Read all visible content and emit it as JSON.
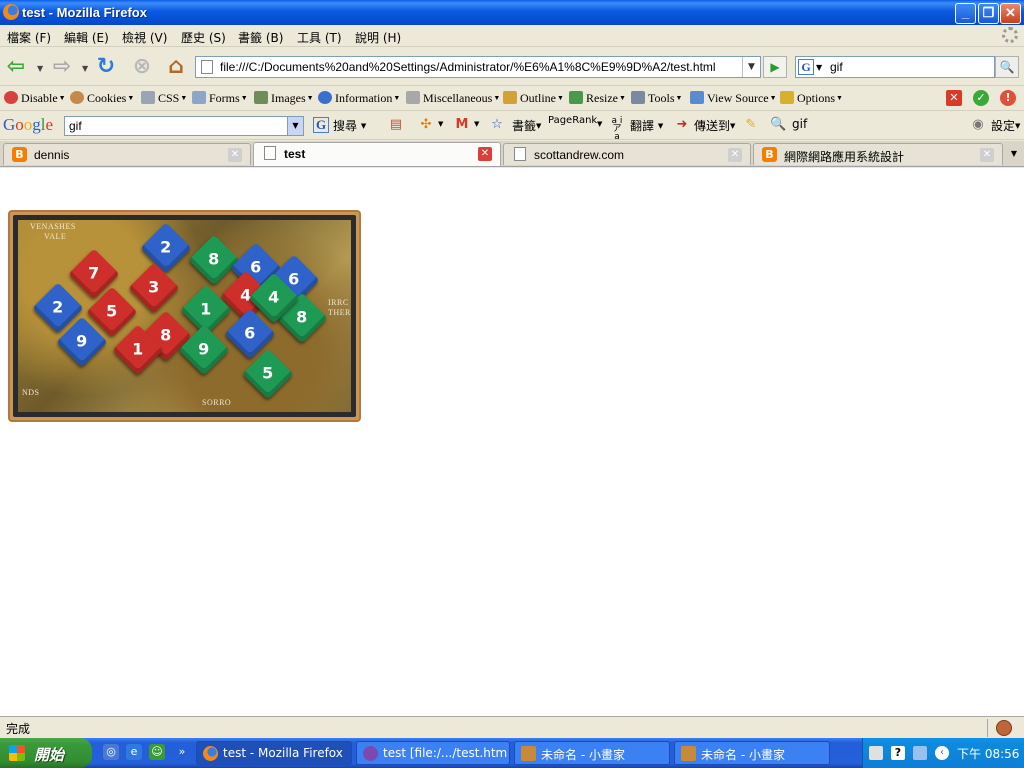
{
  "window": {
    "title": "test - Mozilla Firefox"
  },
  "menu": [
    "檔案 (F)",
    "編輯 (E)",
    "檢視 (V)",
    "歷史 (S)",
    "書籤 (B)",
    "工具 (T)",
    "說明 (H)"
  ],
  "nav": {
    "url": "file:///C:/Documents%20and%20Settings/Administrator/%E6%A1%8C%E9%9D%A2/test.html",
    "search_value": "gif"
  },
  "devtoolbar": {
    "items": [
      "Disable",
      "Cookies",
      "CSS",
      "Forms",
      "Images",
      "Information",
      "Miscellaneous",
      "Outline",
      "Resize",
      "Tools",
      "View Source",
      "Options"
    ]
  },
  "googlebar": {
    "logo": "Google",
    "search_value": "gif",
    "search_label": "搜尋",
    "bookmarks_label": "書籤",
    "pagerank_label": "PageRank",
    "translate_label": "翻譯",
    "sendto_label": "傳送到",
    "gif_label": "gif",
    "settings_label": "設定"
  },
  "tabs": [
    {
      "label": "dennis",
      "active": false
    },
    {
      "label": "test",
      "active": true
    },
    {
      "label": "scottandrew.com",
      "active": false
    },
    {
      "label": "網際網路應用系統設計",
      "active": false
    }
  ],
  "content": {
    "image_map_labels": [
      "VENASHES",
      "VALE",
      "IRRC",
      "THER",
      "NDS",
      "SORRO"
    ],
    "dice_numbers": [
      "2",
      "7",
      "8",
      "6",
      "2",
      "3",
      "6",
      "4",
      "5",
      "8",
      "1",
      "9",
      "8",
      "6",
      "4",
      "1",
      "9",
      "5"
    ]
  },
  "status": {
    "text": "完成"
  },
  "taskbar": {
    "start_label": "開始",
    "tasks": [
      {
        "label": "test - Mozilla Firefox"
      },
      {
        "label": "test [file:/.../test.html] -..."
      },
      {
        "label": "未命名 - 小畫家"
      },
      {
        "label": "未命名 - 小畫家"
      }
    ],
    "clock": "下午 08:56"
  }
}
